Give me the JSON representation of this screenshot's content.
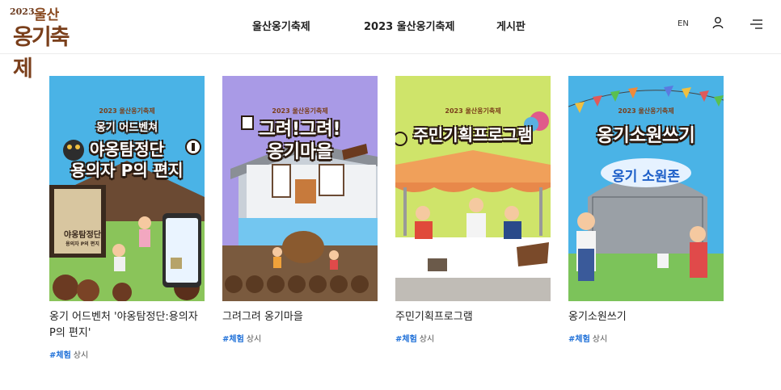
{
  "header": {
    "logo": {
      "year": "2023",
      "line1": "울산",
      "line2": "옹기축제"
    },
    "nav": [
      "울산옹기축제",
      "2023 울산옹기축제",
      "게시판"
    ],
    "lang_label": "EN",
    "user_icon": "user-icon",
    "menu_icon": "hamburger-menu-icon"
  },
  "cards": [
    {
      "title": "옹기 어드벤처 '야옹탐정단:용의자 P의 편지'",
      "tag": "#체험",
      "status": "상시",
      "poster": {
        "small_logo": "2023 울산옹기축제",
        "lines": [
          "옹기 어드벤쳐",
          "야옹탐정단",
          "용의자 P의 편지"
        ],
        "sign_lines": [
          "야옹탐정단",
          "용의자 P의 편지"
        ],
        "bg": "#4ab3e6"
      }
    },
    {
      "title": "그려그려 옹기마을",
      "tag": "#체험",
      "status": "상시",
      "poster": {
        "small_logo": "2023 울산옹기축제",
        "lines": [
          "그려!그려!",
          "옹기마을"
        ],
        "bg": "#a99ae6"
      }
    },
    {
      "title": "주민기획프로그램",
      "tag": "#체험",
      "status": "상시",
      "poster": {
        "small_logo": "2023 울산옹기축제",
        "lines": [
          "주민기획프로그램"
        ],
        "bg": "#cfe46a"
      }
    },
    {
      "title": "옹기소원쓰기",
      "tag": "#체험",
      "status": "상시",
      "poster": {
        "small_logo": "2023 울산옹기축제",
        "lines": [
          "옹기소원쓰기"
        ],
        "sub": "옹기 소원존",
        "bg": "#4ab3e6"
      }
    }
  ]
}
